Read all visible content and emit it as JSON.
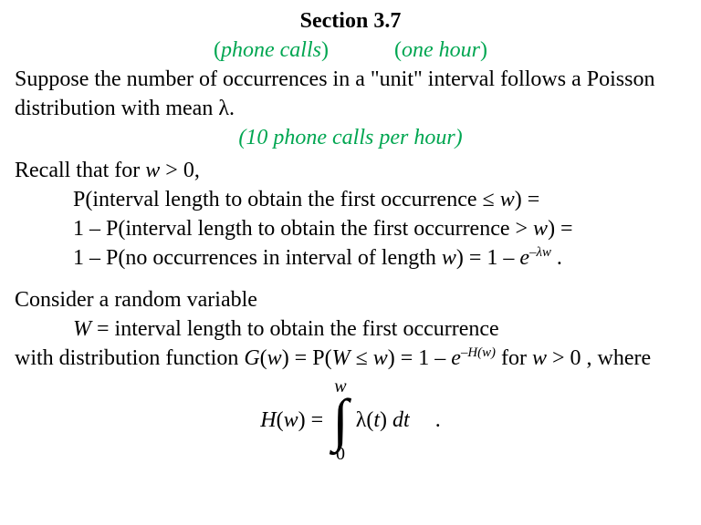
{
  "title": "Section 3.7",
  "green1": {
    "left": "phone calls",
    "right": "one hour"
  },
  "para1a": "Suppose the number of occurrences in a \"unit\" interval follows a Poisson",
  "para1b_prefix": "distribution with mean ",
  "lambda": "λ",
  "green2": "10 phone calls per hour",
  "recall_prefix": "Recall that for ",
  "w": "w",
  "gt0": " > 0,",
  "line_p1_prefix": "P(interval length to obtain the first occurrence ",
  "le": "≤",
  "line_p1_suffix": ") =",
  "line_p2_prefix": "1 – P(interval length to obtain the first occurrence > ",
  "line_p2_suffix": ") =",
  "line_p3_prefix": "1 – P(no occurrences in interval of length ",
  "line_p3_mid": ") =",
  "one_minus": "1 – ",
  "e": "e",
  "exp_lambda_w": "–λw",
  "consider": "Consider a random variable",
  "W": "W",
  "W_def": " = interval length to obtain the first occurrence",
  "dist_prefix": "with distribution function ",
  "G": "G",
  "of_w_eq_P": ") = P(",
  "le_w_close": ") = 1 – ",
  "exp_Hw": "–H(w)",
  "for_w_gt0": " for ",
  "where": " > 0 , where",
  "Hw_label_H": "H",
  "eq": " = ",
  "lambda_t": "λ(",
  "t": "t",
  "dt": "dt",
  "int_upper": "w",
  "int_lower": "0",
  "dot": "."
}
